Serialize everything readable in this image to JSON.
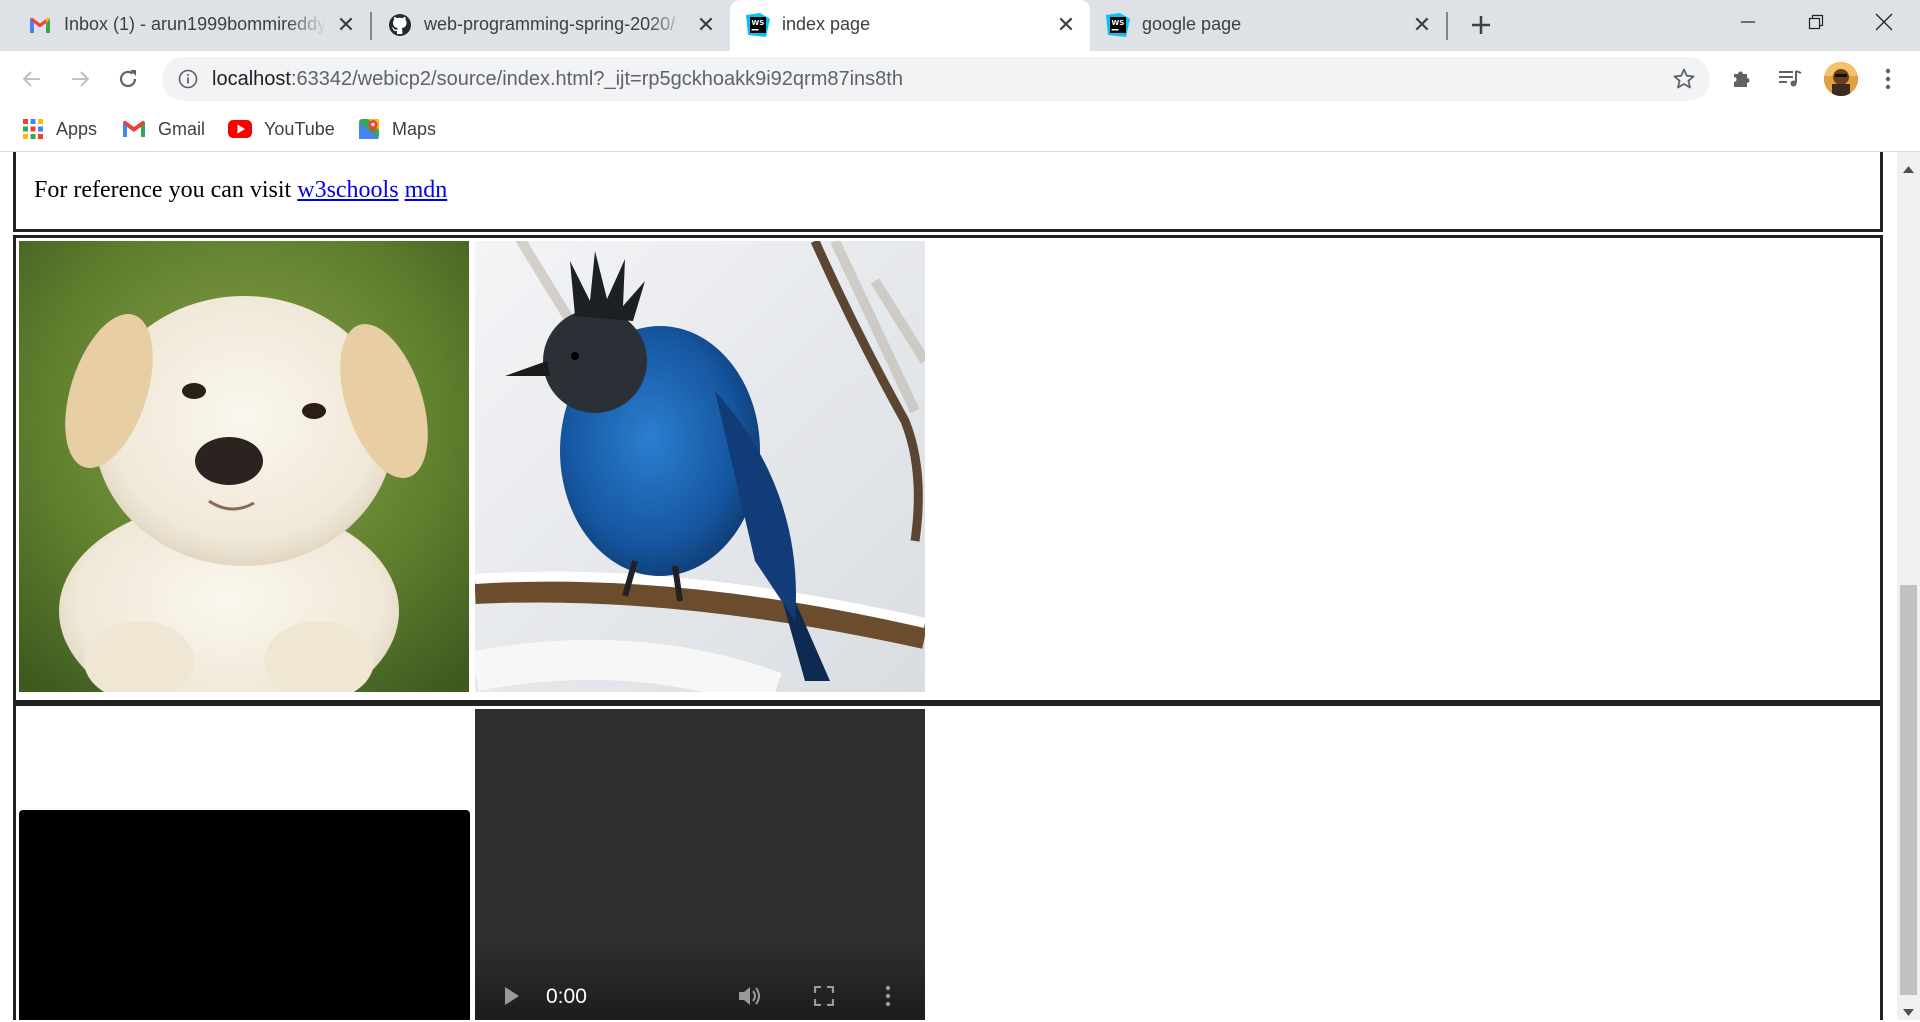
{
  "browser": {
    "tabs": [
      {
        "title": "Inbox (1) - arun1999bommireddy",
        "favicon": "gmail-icon",
        "active": false
      },
      {
        "title": "web-programming-spring-2020/",
        "favicon": "github-icon",
        "active": false
      },
      {
        "title": "index page",
        "favicon": "webstorm-icon",
        "active": true
      },
      {
        "title": "google page",
        "favicon": "webstorm-icon",
        "active": false
      }
    ],
    "new_tab_icon": "plus-icon",
    "window_controls": [
      "minimize-icon",
      "restore-icon",
      "close-icon"
    ],
    "address_bar": {
      "host": "localhost",
      "rest": ":63342/webicp2/source/index.html?_ijt=rp5gckhoakk9i92qrm87ins8th"
    },
    "bookmarks": [
      {
        "label": "Apps",
        "icon": "apps-grid-icon"
      },
      {
        "label": "Gmail",
        "icon": "gmail-icon"
      },
      {
        "label": "YouTube",
        "icon": "youtube-icon"
      },
      {
        "label": "Maps",
        "icon": "maps-icon"
      }
    ]
  },
  "page": {
    "reference": {
      "text": "For reference you can visit",
      "links": [
        "w3schools",
        "mdn"
      ]
    },
    "images": [
      {
        "subject": "white puppy"
      },
      {
        "subject": "blue jay on snowy branch"
      }
    ],
    "video_controls": {
      "time": "0:00"
    }
  },
  "colors": {
    "tabstrip": "#dee1e6",
    "link": "#0000ee",
    "video_bg": "#2f2f2f"
  }
}
